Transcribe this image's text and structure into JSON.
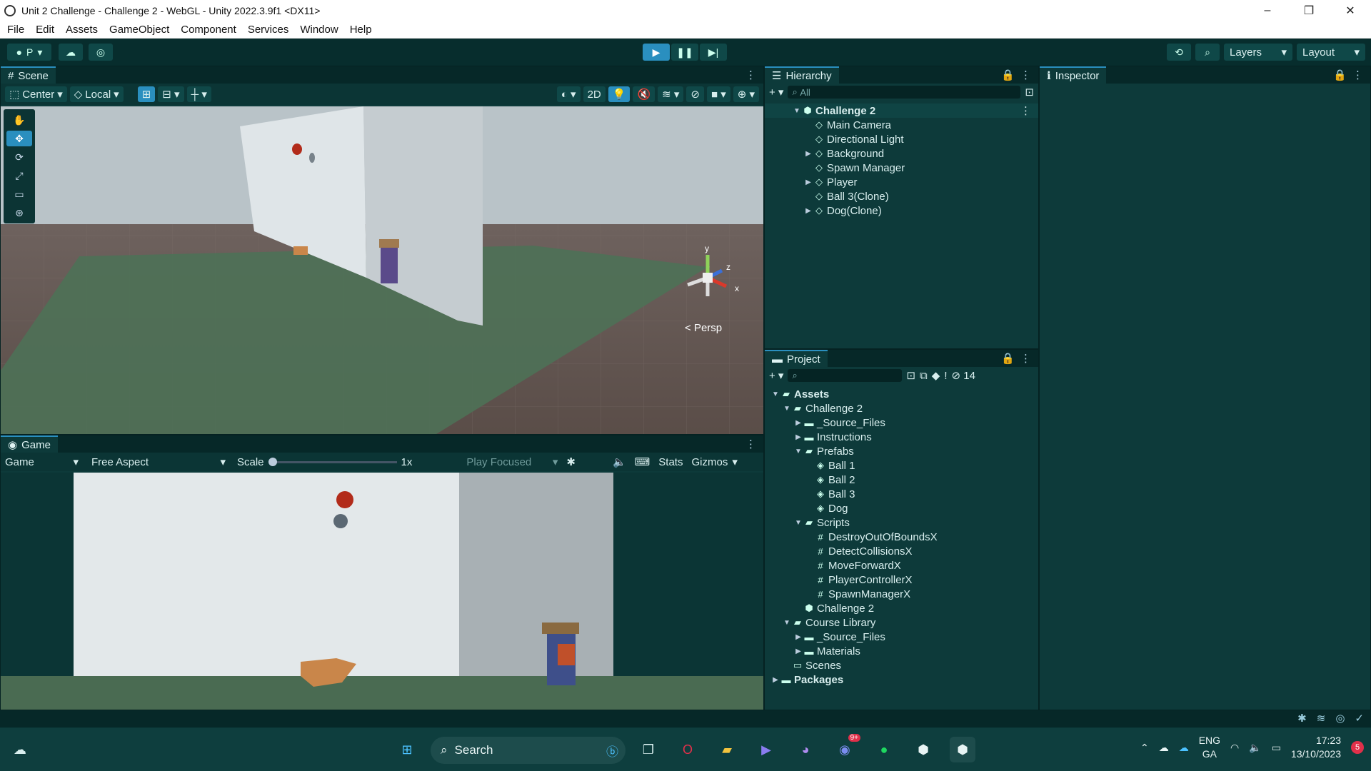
{
  "window": {
    "title": "Unit 2 Challenge - Challenge 2 - WebGL - Unity 2022.3.9f1 <DX11>",
    "minimize": "–",
    "restore": "❐",
    "close": "✕"
  },
  "menu": [
    "File",
    "Edit",
    "Assets",
    "GameObject",
    "Component",
    "Services",
    "Window",
    "Help"
  ],
  "toolbar": {
    "account": "P",
    "layers": "Layers",
    "layout": "Layout"
  },
  "scene": {
    "tab": "Scene",
    "pivot": "Center",
    "space": "Local",
    "mode_2d": "2D",
    "axis_x": "x",
    "axis_y": "y",
    "axis_z": "z",
    "persp": "Persp"
  },
  "game": {
    "tab": "Game",
    "display": "Game",
    "aspect": "Free Aspect",
    "scale_label": "Scale",
    "scale_value": "1x",
    "play_mode": "Play Focused",
    "stats": "Stats",
    "gizmos": "Gizmos"
  },
  "hierarchy": {
    "tab": "Hierarchy",
    "search_placeholder": "All",
    "scene_name": "Challenge 2",
    "items": [
      {
        "label": "Main Camera",
        "expandable": false
      },
      {
        "label": "Directional Light",
        "expandable": false
      },
      {
        "label": "Background",
        "expandable": true
      },
      {
        "label": "Spawn Manager",
        "expandable": false
      },
      {
        "label": "Player",
        "expandable": true
      },
      {
        "label": "Ball 3(Clone)",
        "expandable": false
      },
      {
        "label": "Dog(Clone)",
        "expandable": true
      }
    ]
  },
  "inspector": {
    "tab": "Inspector"
  },
  "project": {
    "tab": "Project",
    "hidden_count": "14",
    "tree": [
      {
        "label": "Assets",
        "depth": 0,
        "arrow": "open",
        "icon": "folder-open",
        "bold": true
      },
      {
        "label": "Challenge 2",
        "depth": 1,
        "arrow": "open",
        "icon": "folder-open"
      },
      {
        "label": "_Source_Files",
        "depth": 2,
        "arrow": "closed",
        "icon": "folder"
      },
      {
        "label": "Instructions",
        "depth": 2,
        "arrow": "closed",
        "icon": "folder"
      },
      {
        "label": "Prefabs",
        "depth": 2,
        "arrow": "open",
        "icon": "folder-open"
      },
      {
        "label": "Ball 1",
        "depth": 3,
        "arrow": "none",
        "icon": "prefab"
      },
      {
        "label": "Ball 2",
        "depth": 3,
        "arrow": "none",
        "icon": "prefab"
      },
      {
        "label": "Ball 3",
        "depth": 3,
        "arrow": "none",
        "icon": "prefab"
      },
      {
        "label": "Dog",
        "depth": 3,
        "arrow": "none",
        "icon": "prefab"
      },
      {
        "label": "Scripts",
        "depth": 2,
        "arrow": "open",
        "icon": "folder-open"
      },
      {
        "label": "DestroyOutOfBoundsX",
        "depth": 3,
        "arrow": "none",
        "icon": "script"
      },
      {
        "label": "DetectCollisionsX",
        "depth": 3,
        "arrow": "none",
        "icon": "script"
      },
      {
        "label": "MoveForwardX",
        "depth": 3,
        "arrow": "none",
        "icon": "script"
      },
      {
        "label": "PlayerControllerX",
        "depth": 3,
        "arrow": "none",
        "icon": "script"
      },
      {
        "label": "SpawnManagerX",
        "depth": 3,
        "arrow": "none",
        "icon": "script"
      },
      {
        "label": "Challenge 2",
        "depth": 2,
        "arrow": "none",
        "icon": "scene"
      },
      {
        "label": "Course Library",
        "depth": 1,
        "arrow": "open",
        "icon": "folder-open"
      },
      {
        "label": "_Source_Files",
        "depth": 2,
        "arrow": "closed",
        "icon": "folder"
      },
      {
        "label": "Materials",
        "depth": 2,
        "arrow": "closed",
        "icon": "folder"
      },
      {
        "label": "Scenes",
        "depth": 1,
        "arrow": "none",
        "icon": "folder-empty"
      },
      {
        "label": "Packages",
        "depth": 0,
        "arrow": "closed",
        "icon": "folder",
        "bold": true
      }
    ]
  },
  "taskbar": {
    "search": "Search",
    "lang_top": "ENG",
    "lang_bottom": "GA",
    "time": "17:23",
    "date": "13/10/2023",
    "notifications": "5",
    "discord_badge": "9+"
  },
  "colors": {
    "accent": "#2a8fbf",
    "panel": "#0d3a3a",
    "toolbar": "#072d2d"
  }
}
